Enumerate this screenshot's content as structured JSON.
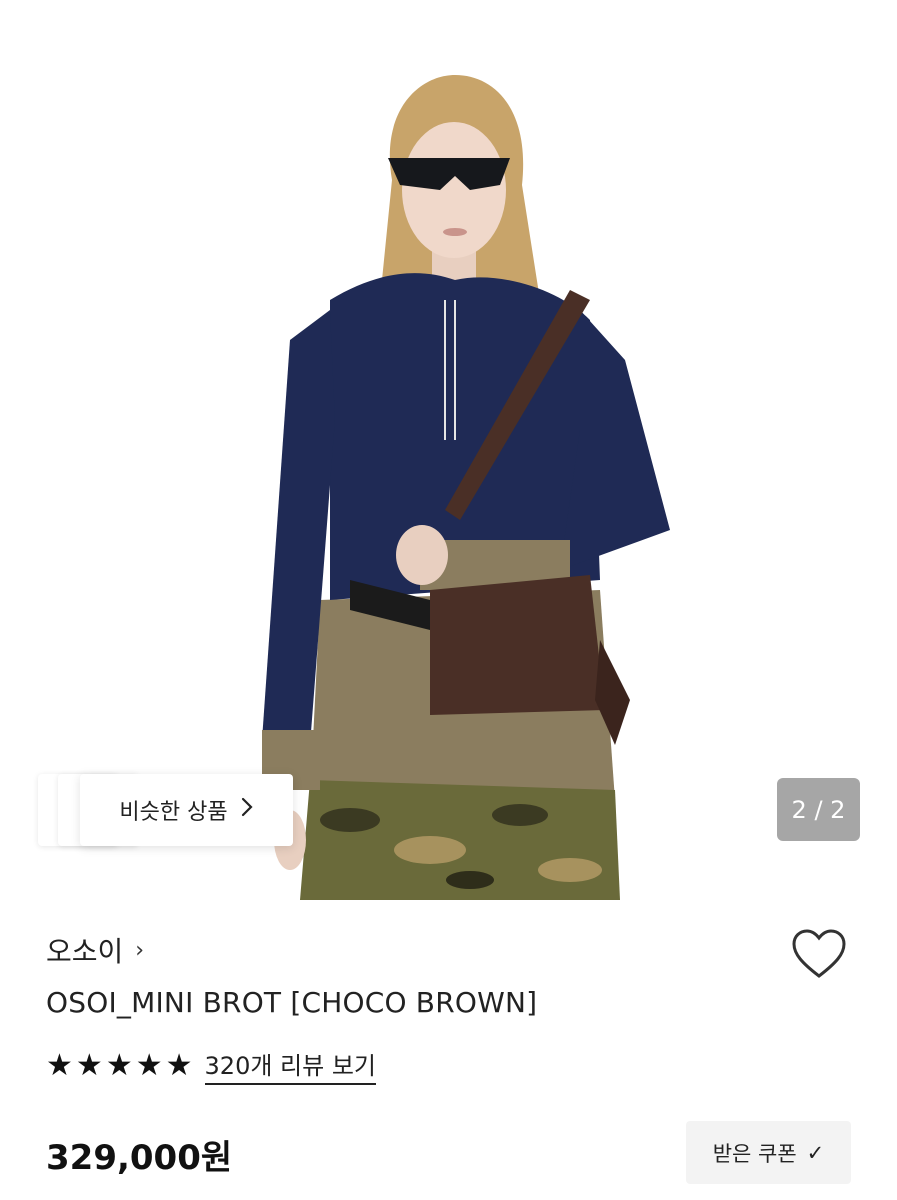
{
  "gallery": {
    "page_current": "2",
    "page_total": "2",
    "page_indicator": "2 / 2",
    "similar_label": "비슷한 상품",
    "chevron_icon": "chevron-right-icon"
  },
  "product": {
    "brand": "오소이",
    "brand_chevron": "›",
    "name": "OSOI_MINI BROT [CHOCO BROWN]",
    "rating_value": 5,
    "review_link": "320개 리뷰 보기",
    "price": "329,000원",
    "coupon_label": "받은 쿠폰",
    "coupon_check": "✓"
  },
  "colors": {
    "hoodie": "#1f2a55",
    "bag": "#4a2f26",
    "under_hoodie": "#8b7d5f",
    "hair": "#c8a46a"
  }
}
